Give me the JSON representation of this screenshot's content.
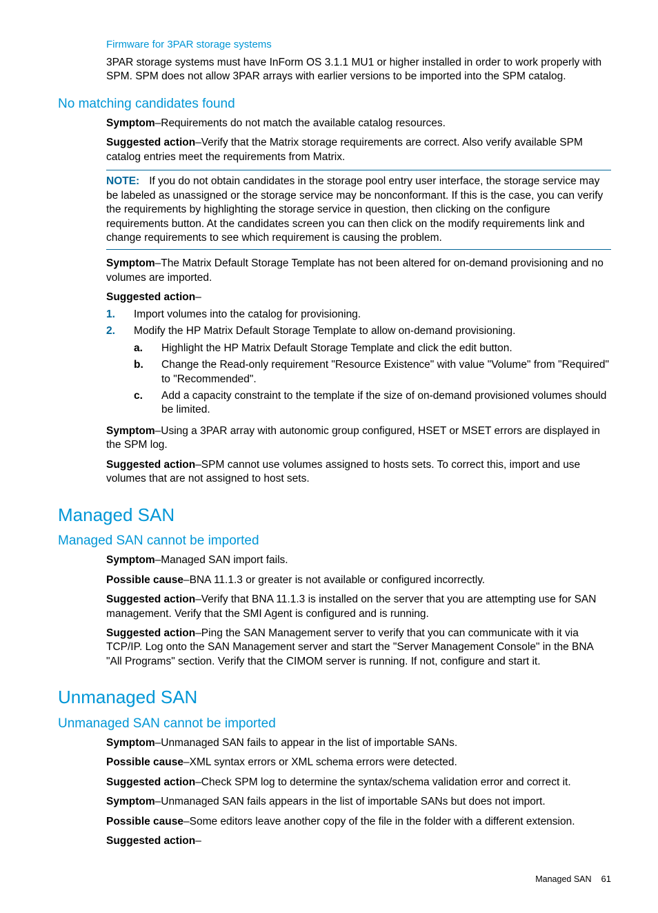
{
  "firmware": {
    "heading": "Firmware for 3PAR storage systems",
    "body": "3PAR storage systems must have InForm OS 3.1.1 MU1 or higher installed in order to work properly with SPM. SPM does not allow 3PAR arrays with earlier versions to be imported into the SPM catalog."
  },
  "nomatch": {
    "heading": "No matching candidates found",
    "symptom1_label": "Symptom",
    "symptom1": "–Requirements do not match the available catalog resources.",
    "sugg1_label": "Suggested action",
    "sugg1": "–Verify that the Matrix storage requirements are correct. Also verify available SPM catalog entries meet the requirements from Matrix.",
    "note_label": "NOTE:",
    "note": "If you do not obtain candidates in the storage pool entry user interface, the storage service may be labeled as unassigned or the storage service may be nonconformant. If this is the case, you can verify the requirements by highlighting the storage service in question, then clicking on the configure requirements button. At the candidates screen you can then click on the modify requirements link and change requirements to see which requirement is causing the problem.",
    "symptom2_label": "Symptom",
    "symptom2": "–The Matrix Default Storage Template has not been altered for on-demand provisioning and no volumes are imported.",
    "sugg2_label": "Suggested action",
    "sugg2_dash": "–",
    "step1": "Import volumes into the catalog for provisioning.",
    "step2": "Modify the HP Matrix Default Storage Template to allow on-demand provisioning.",
    "step2a": "Highlight the HP Matrix Default Storage Template and click the edit button.",
    "step2b": "Change the Read-only requirement \"Resource Existence\" with value \"Volume\" from \"Required\" to \"Recommended\".",
    "step2c": "Add a capacity constraint to the template if the size of on-demand provisioned volumes should be limited.",
    "symptom3_label": "Symptom",
    "symptom3": "–Using a 3PAR array with autonomic group configured, HSET or MSET errors are displayed in the SPM log.",
    "sugg3_label": "Suggested action",
    "sugg3": "–SPM cannot use volumes assigned to hosts sets. To correct this, import and use volumes that are not assigned to host sets."
  },
  "managed": {
    "heading": "Managed SAN",
    "sub": "Managed SAN cannot be imported",
    "symptom_label": "Symptom",
    "symptom": "–Managed SAN import fails.",
    "cause_label": "Possible cause",
    "cause": "–BNA 11.1.3 or greater is not available or configured incorrectly.",
    "sugg1_label": "Suggested action",
    "sugg1": "–Verify that BNA 11.1.3 is installed on the server that you are attempting use for SAN management. Verify that the SMI Agent is configured and is running.",
    "sugg2_label": "Suggested action",
    "sugg2": "–Ping the SAN Management server to verify that you can communicate with it via TCP/IP. Log onto the SAN Management server and start the \"Server Management Console\" in the BNA \"All Programs\" section. Verify that the CIMOM server is running. If not, configure and start it."
  },
  "unmanaged": {
    "heading": "Unmanaged SAN",
    "sub": "Unmanaged SAN cannot be imported",
    "symptom1_label": "Symptom",
    "symptom1": "–Unmanaged SAN fails to appear in the list of importable SANs.",
    "cause1_label": "Possible cause",
    "cause1": "–XML syntax errors or XML schema errors were detected.",
    "sugg1_label": "Suggested action",
    "sugg1": "–Check SPM log to determine the syntax/schema validation error and correct it.",
    "symptom2_label": "Symptom",
    "symptom2": "–Unmanaged SAN fails appears in the list of importable SANs but does not import.",
    "cause2_label": "Possible cause",
    "cause2": "–Some editors leave another copy of the file in the folder with a different extension.",
    "sugg2_label": "Suggested action",
    "sugg2_dash": "–"
  },
  "footer": {
    "section": "Managed SAN",
    "page": "61"
  },
  "markers": {
    "one": "1.",
    "two": "2.",
    "a": "a.",
    "b": "b.",
    "c": "c."
  }
}
